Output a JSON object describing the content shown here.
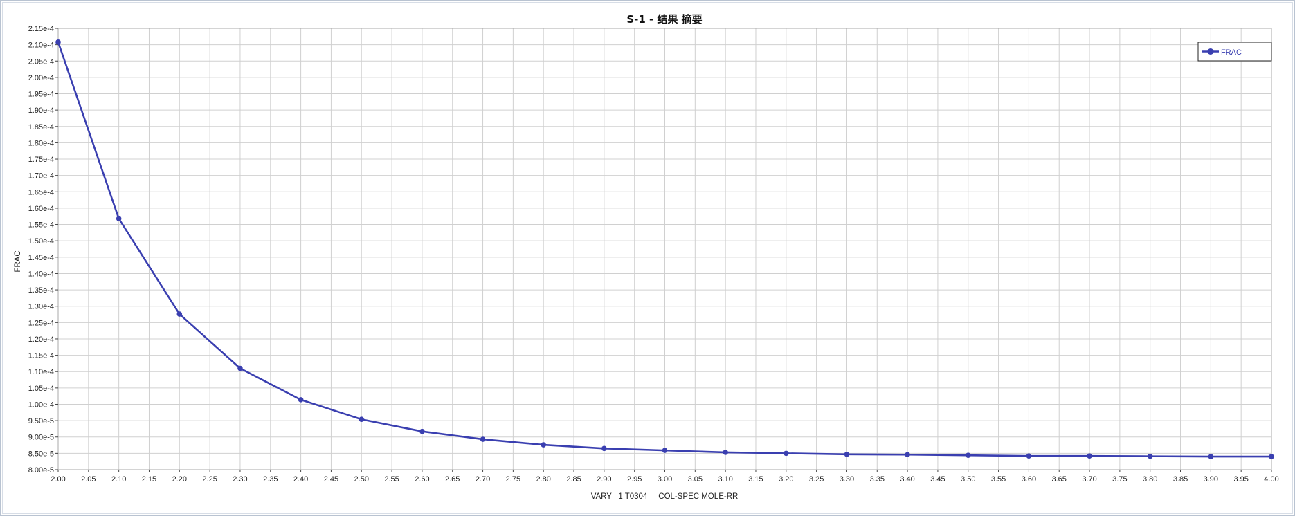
{
  "chart_data": {
    "type": "line",
    "title": "S-1 - 结果 摘要",
    "xlabel": "VARY   1 T0304     COL-SPEC MOLE-RR",
    "ylabel": "FRAC",
    "xlim": [
      2.0,
      4.0
    ],
    "ylim": [
      8e-05,
      0.000215
    ],
    "x_ticks": [
      "2.00",
      "2.05",
      "2.10",
      "2.15",
      "2.20",
      "2.25",
      "2.30",
      "2.35",
      "2.40",
      "2.45",
      "2.50",
      "2.55",
      "2.60",
      "2.65",
      "2.70",
      "2.75",
      "2.80",
      "2.85",
      "2.90",
      "2.95",
      "3.00",
      "3.05",
      "3.10",
      "3.15",
      "3.20",
      "3.25",
      "3.30",
      "3.35",
      "3.40",
      "3.45",
      "3.50",
      "3.55",
      "3.60",
      "3.65",
      "3.70",
      "3.75",
      "3.80",
      "3.85",
      "3.90",
      "3.95",
      "4.00"
    ],
    "y_ticks": [
      "8.00e-5",
      "8.50e-5",
      "9.00e-5",
      "9.50e-5",
      "1.00e-4",
      "1.05e-4",
      "1.10e-4",
      "1.15e-4",
      "1.20e-4",
      "1.25e-4",
      "1.30e-4",
      "1.35e-4",
      "1.40e-4",
      "1.45e-4",
      "1.50e-4",
      "1.55e-4",
      "1.60e-4",
      "1.65e-4",
      "1.70e-4",
      "1.75e-4",
      "1.80e-4",
      "1.85e-4",
      "1.90e-4",
      "1.95e-4",
      "2.00e-4",
      "2.05e-4",
      "2.10e-4",
      "2.15e-4"
    ],
    "grid": true,
    "legend_position": "top-right",
    "series": [
      {
        "name": "FRAC",
        "color": "#3a3fb0",
        "x": [
          2.0,
          2.1,
          2.2,
          2.3,
          2.4,
          2.5,
          2.6,
          2.7,
          2.8,
          2.9,
          3.0,
          3.1,
          3.2,
          3.3,
          3.4,
          3.5,
          3.6,
          3.7,
          3.8,
          3.9,
          4.0
        ],
        "y": [
          0.0002108,
          0.0001568,
          0.0001276,
          0.000111,
          0.0001014,
          9.54e-05,
          9.17e-05,
          8.93e-05,
          8.76e-05,
          8.65e-05,
          8.59e-05,
          8.53e-05,
          8.5e-05,
          8.47e-05,
          8.46e-05,
          8.44e-05,
          8.42e-05,
          8.42e-05,
          8.41e-05,
          8.4e-05,
          8.4e-05
        ]
      }
    ]
  },
  "colors": {
    "series": "#3a3fb0",
    "grid": "#d0d0d0",
    "plot_border": "#a8a8a8"
  }
}
